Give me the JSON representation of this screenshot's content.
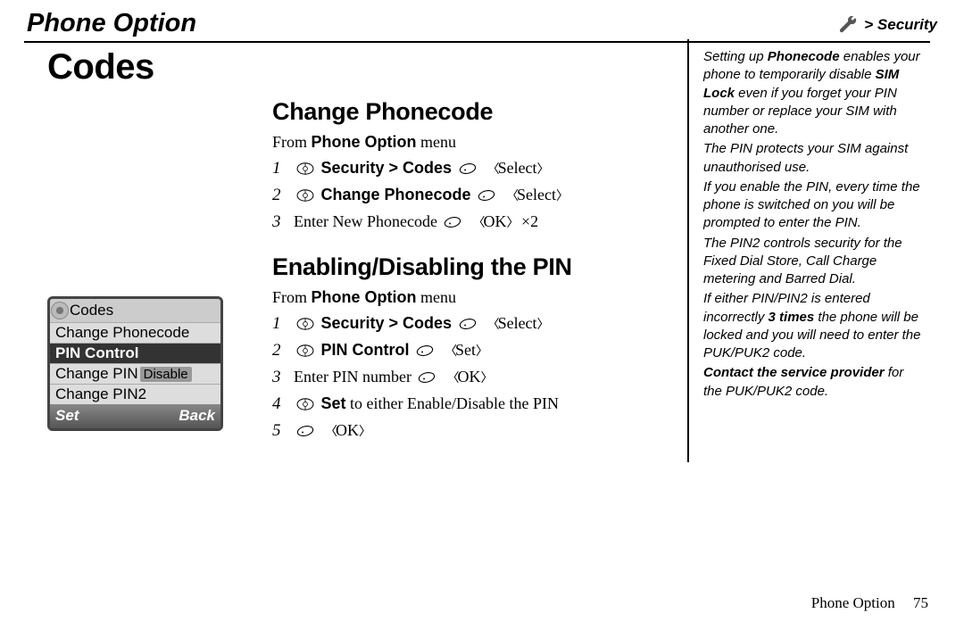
{
  "header": {
    "left": "Phone Option",
    "right": "> Security",
    "icon": "wrench"
  },
  "title": "Codes",
  "sections": [
    {
      "heading": "Change Phonecode",
      "from_pre": "From ",
      "from_bold": "Phone Option",
      "from_post": " menu",
      "steps": [
        {
          "n": "1",
          "text_pre": "",
          "bold": "Security > Codes",
          "text_mid": " ",
          "tail": "Select",
          "nav": true,
          "btn_after_bold": true
        },
        {
          "n": "2",
          "text_pre": "",
          "bold": "Change Phonecode",
          "text_mid": " ",
          "tail": "Select",
          "nav": true,
          "btn_after_bold": true
        },
        {
          "n": "3",
          "text_pre": "Enter New Phonecode ",
          "bold": "",
          "text_mid": "",
          "tail": "OK",
          "suffix": " ×2",
          "nav": false,
          "btn_after_bold": true
        }
      ]
    },
    {
      "heading": "Enabling/Disabling the PIN",
      "from_pre": "From ",
      "from_bold": "Phone Option",
      "from_post": " menu",
      "steps": [
        {
          "n": "1",
          "text_pre": "",
          "bold": "Security > Codes",
          "text_mid": " ",
          "tail": "Select",
          "nav": true,
          "btn_after_bold": true
        },
        {
          "n": "2",
          "text_pre": "",
          "bold": "PIN Control",
          "text_mid": " ",
          "tail": "Set",
          "nav": true,
          "btn_after_bold": true
        },
        {
          "n": "3",
          "text_pre": "Enter PIN number ",
          "bold": "",
          "text_mid": "",
          "tail": "OK",
          "nav": false,
          "btn_after_bold": true
        },
        {
          "n": "4",
          "text_pre": "",
          "bold": "Set",
          "text_mid": " to either Enable/Disable the PIN",
          "tail": "",
          "nav": true,
          "btn_after_bold": false
        },
        {
          "n": "5",
          "text_pre": "",
          "bold": "",
          "text_mid": "",
          "tail": "OK",
          "nav": false,
          "btn_after_bold": true
        }
      ]
    }
  ],
  "phone": {
    "title": "Codes",
    "row1": "Change Phonecode",
    "row2": "PIN Control",
    "row3_pre": "Change PIN",
    "row3_tag": "Disable",
    "row4": "Change PIN2",
    "soft_left": "Set",
    "soft_right": "Back"
  },
  "sidebar": {
    "p1_pre": "Setting up ",
    "p1_b1": "Phonecode",
    "p1_mid": " enables your phone to temporarily disable ",
    "p1_b2": "SIM Lock",
    "p1_post": " even if you forget your PIN number or replace your SIM with another one.",
    "p2": "The PIN protects your SIM against unauthorised use.",
    "p3": "If you enable the PIN, every time the phone is switched on you will be prompted to enter the PIN.",
    "p4": "The PIN2 controls security for the Fixed Dial Store, Call Charge metering and Barred Dial.",
    "p5_pre": "If either PIN/PIN2 is entered incorrectly ",
    "p5_b": "3 times",
    "p5_post": " the phone will be locked and you will need to enter the PUK/PUK2 code.",
    "p6_b": "Contact the service provider",
    "p6_post": " for the PUK/PUK2 code."
  },
  "footer": {
    "label": "Phone Option",
    "page": "75"
  }
}
